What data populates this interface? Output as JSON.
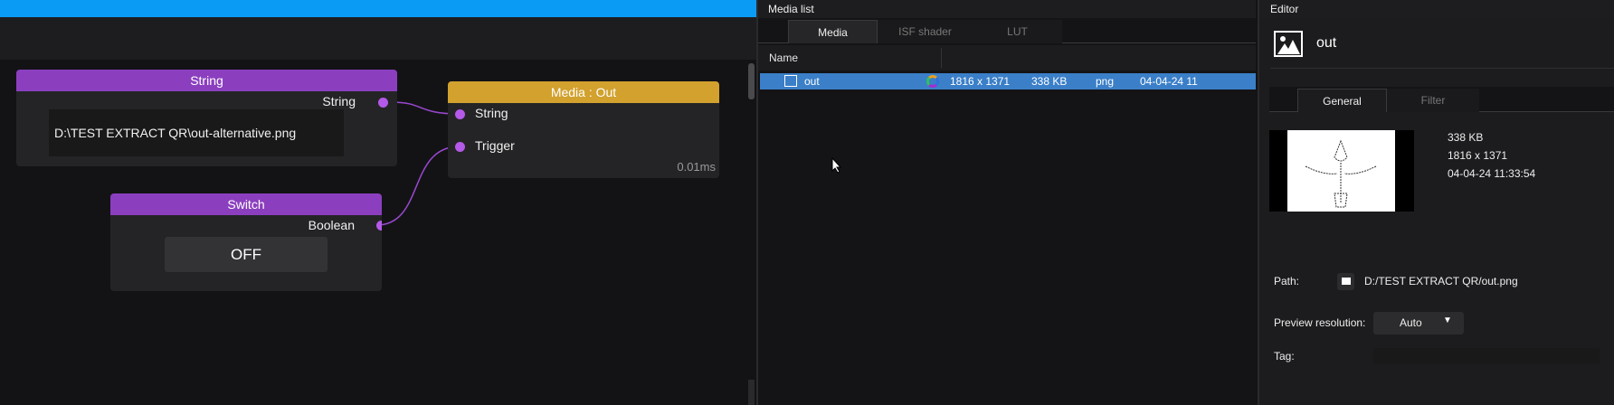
{
  "graph": {
    "string_node": {
      "title": "String",
      "output_label": "String",
      "value": "D:\\TEST EXTRACT QR\\out-alternative.png"
    },
    "media_out_node": {
      "title": "Media : Out",
      "inputs": [
        "String",
        "Trigger"
      ],
      "timing": "0.01ms"
    },
    "switch_node": {
      "title": "Switch",
      "output_label": "Boolean",
      "button_label": "OFF"
    }
  },
  "media_list": {
    "title": "Media list",
    "tabs": [
      "Media",
      "ISF shader",
      "LUT"
    ],
    "column_header": "Name",
    "rows": [
      {
        "name": "out",
        "resolution": "1816 x 1371",
        "size": "338 KB",
        "format": "png",
        "date": "04-04-24 11"
      }
    ]
  },
  "editor": {
    "title": "Editor",
    "media_name": "out",
    "tabs": [
      "General",
      "Filter"
    ],
    "size": "338 KB",
    "resolution": "1816 x 1371",
    "date": "04-04-24 11:33:54",
    "path_label": "Path:",
    "path_value": "D:/TEST EXTRACT QR/out.png",
    "preview_label": "Preview resolution:",
    "preview_value": "Auto",
    "tag_label": "Tag:"
  }
}
